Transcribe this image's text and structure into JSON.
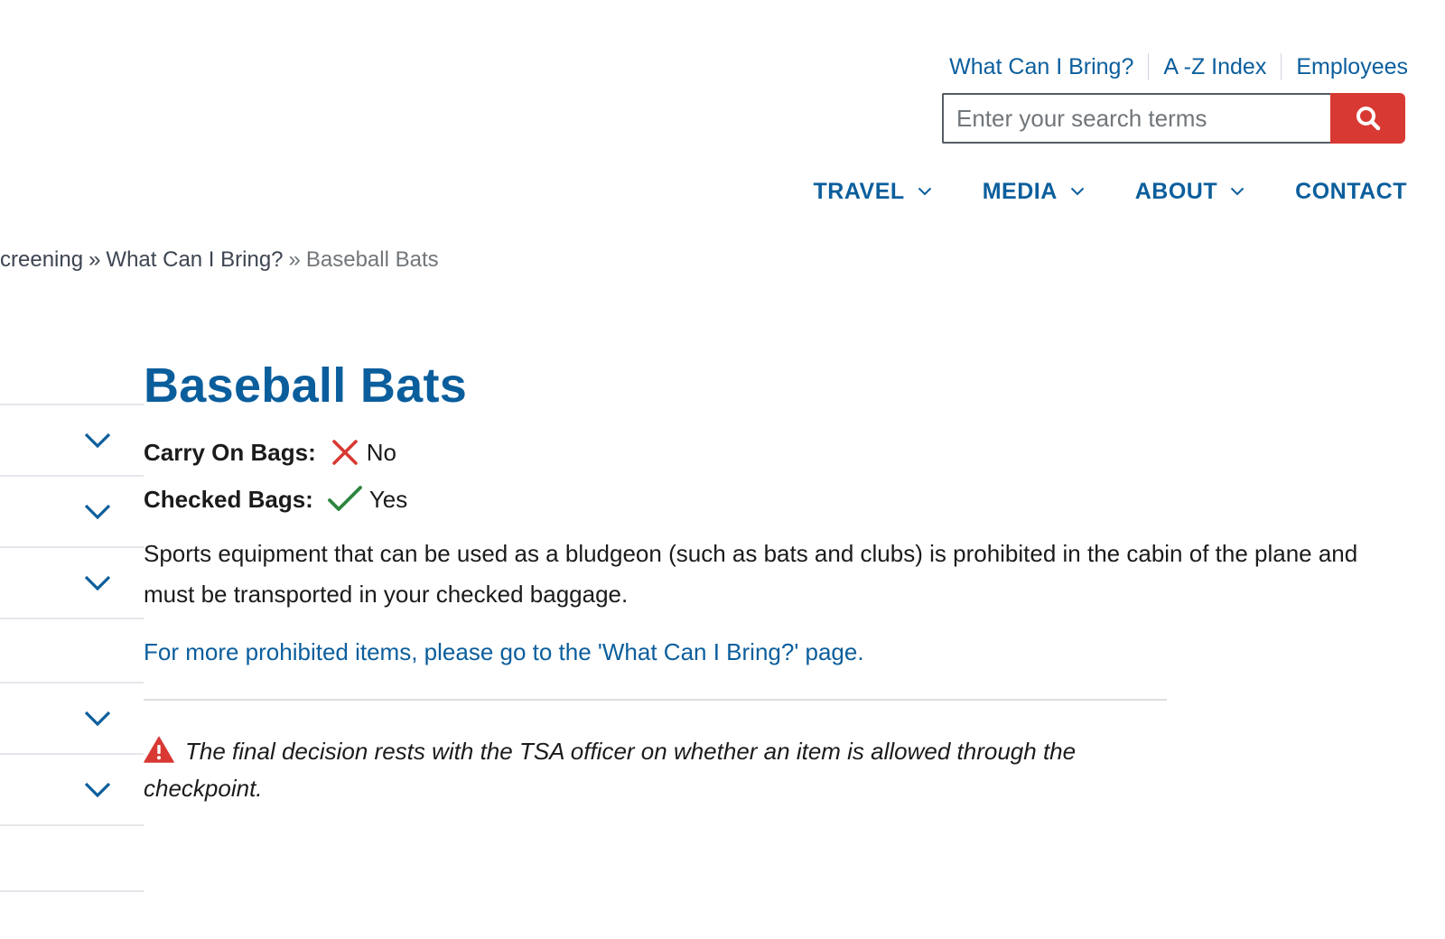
{
  "utility_nav": {
    "items": [
      "What Can I Bring?",
      "A -Z Index",
      "Employees"
    ]
  },
  "search": {
    "placeholder": "Enter your search terms",
    "button_icon": "search-icon"
  },
  "main_nav": {
    "items": [
      {
        "label": "TRAVEL",
        "has_dropdown": true
      },
      {
        "label": "MEDIA",
        "has_dropdown": true
      },
      {
        "label": "ABOUT",
        "has_dropdown": true
      },
      {
        "label": "CONTACT",
        "has_dropdown": false
      }
    ]
  },
  "breadcrumb": {
    "items": [
      "creening",
      "What Can I Bring?",
      "Baseball Bats"
    ],
    "separator": "»"
  },
  "sidebar": {
    "rows": [
      {
        "icon": "chevron-down-icon"
      },
      {
        "icon": "chevron-down-icon"
      },
      {
        "icon": "chevron-down-icon"
      },
      {
        "icon": null
      },
      {
        "icon": "chevron-down-icon"
      },
      {
        "icon": "chevron-down-icon"
      }
    ]
  },
  "item": {
    "title": "Baseball Bats",
    "carry_on": {
      "label": "Carry On Bags:",
      "value": "No",
      "icon": "x-icon"
    },
    "checked": {
      "label": "Checked Bags:",
      "value": "Yes",
      "icon": "check-icon"
    },
    "description": "Sports equipment that can be used as a bludgeon (such as bats and clubs) is prohibited in the cabin of the plane and must be transported in your checked baggage.",
    "more_link": "For more prohibited items, please go to the 'What Can I Bring?' page.",
    "note": "The final decision rests with the TSA officer on whether an item is allowed through the checkpoint."
  },
  "colors": {
    "brand_blue": "#0b5e9c",
    "search_button_red": "#d83933",
    "prohibited_red": "#d83933",
    "allowed_green": "#2e8540",
    "warning_red": "#d83933"
  }
}
